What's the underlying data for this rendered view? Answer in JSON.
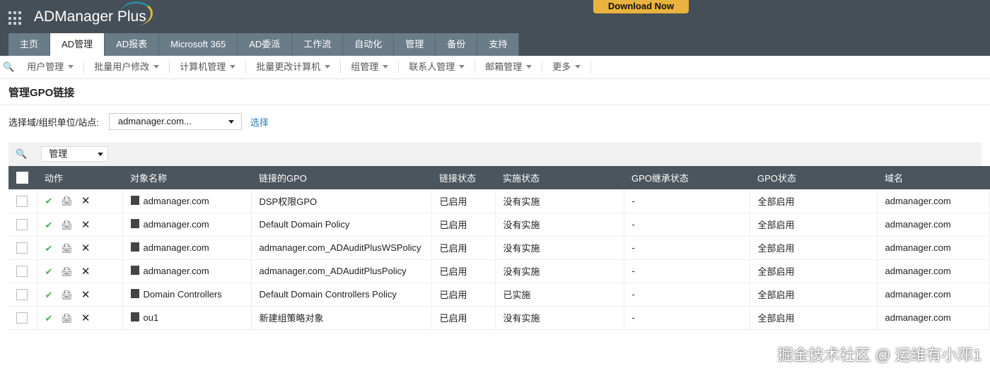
{
  "header": {
    "app_title": "ADManager Plus",
    "download": "Download Now"
  },
  "tabs": [
    "主页",
    "AD管理",
    "AD报表",
    "Microsoft 365",
    "AD委派",
    "工作流",
    "自动化",
    "管理",
    "备份",
    "支持"
  ],
  "subnav": [
    "用户管理",
    "批量用户修改",
    "计算机管理",
    "批量更改计算机",
    "组管理",
    "联系人管理",
    "邮箱管理",
    "更多"
  ],
  "page_title": "管理GPO链接",
  "selector": {
    "label": "选择域/组织单位/站点:",
    "value": "admanager.com...",
    "link": "选择"
  },
  "toolbar": {
    "action_select": "管理"
  },
  "table": {
    "columns": [
      "动作",
      "对象名称",
      "链接的GPO",
      "链接状态",
      "实施状态",
      "GPO继承状态",
      "GPO状态",
      "域名"
    ],
    "rows": [
      {
        "object": "admanager.com",
        "gpo": "DSP权限GPO",
        "link": "已启用",
        "enforce": "没有实施",
        "inherit": "-",
        "gpo_status": "全部启用",
        "domain": "admanager.com"
      },
      {
        "object": "admanager.com",
        "gpo": "Default Domain Policy",
        "link": "已启用",
        "enforce": "没有实施",
        "inherit": "-",
        "gpo_status": "全部启用",
        "domain": "admanager.com"
      },
      {
        "object": "admanager.com",
        "gpo": "admanager.com_ADAuditPlusWSPolicy",
        "link": "已启用",
        "enforce": "没有实施",
        "inherit": "-",
        "gpo_status": "全部启用",
        "domain": "admanager.com"
      },
      {
        "object": "admanager.com",
        "gpo": "admanager.com_ADAuditPlusPolicy",
        "link": "已启用",
        "enforce": "没有实施",
        "inherit": "-",
        "gpo_status": "全部启用",
        "domain": "admanager.com"
      },
      {
        "object": "Domain Controllers",
        "gpo": "Default Domain Controllers Policy",
        "link": "已启用",
        "enforce": "已实施",
        "inherit": "-",
        "gpo_status": "全部启用",
        "domain": "admanager.com"
      },
      {
        "object": "ou1",
        "gpo": "新建组策略对象",
        "link": "已启用",
        "enforce": "没有实施",
        "inherit": "-",
        "gpo_status": "全部启用",
        "domain": "admanager.com"
      }
    ]
  },
  "watermark": "掘金技术社区 @ 运维有小邓1"
}
